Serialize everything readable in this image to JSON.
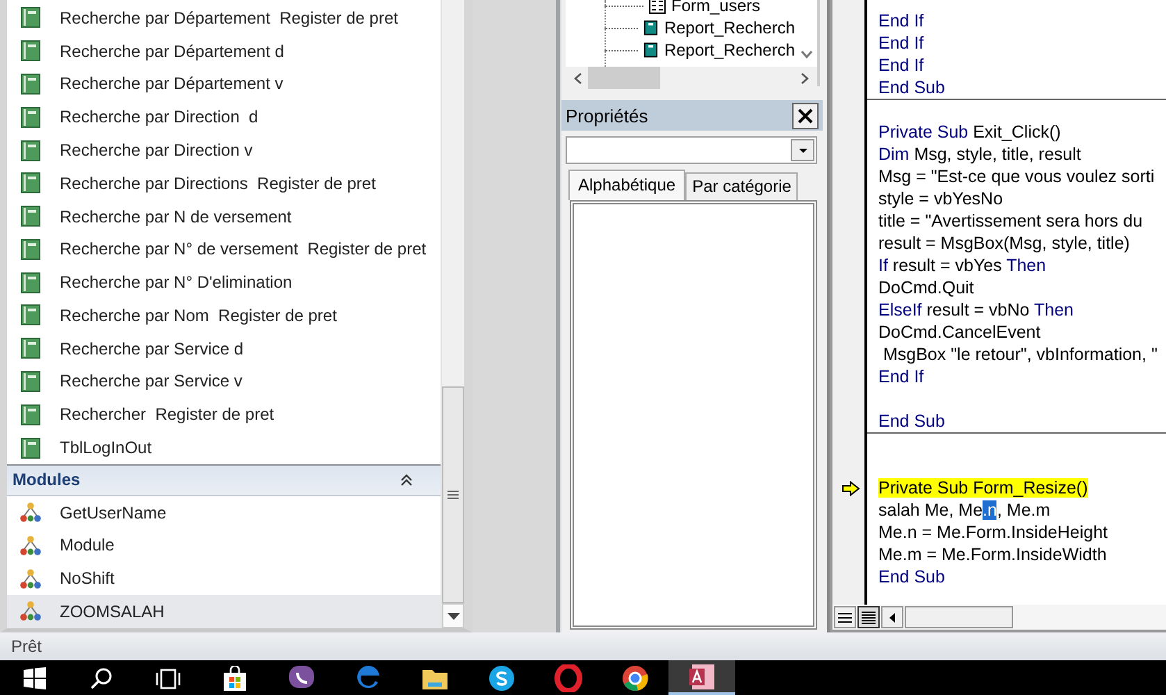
{
  "navigation_pane": {
    "form_items": [
      {
        "label": "Recherche par Département  Register de pret",
        "selected": false
      },
      {
        "label": "Recherche par Département d",
        "selected": false
      },
      {
        "label": "Recherche par Département v",
        "selected": false
      },
      {
        "label": "Recherche par Direction  d",
        "selected": false
      },
      {
        "label": "Recherche par Direction v",
        "selected": false
      },
      {
        "label": "Recherche par Directions  Register de pret",
        "selected": false
      },
      {
        "label": "Recherche par N de versement",
        "selected": false
      },
      {
        "label": "Recherche par N° de versement  Register de pret",
        "selected": false
      },
      {
        "label": "Recherche par N° D'elimination",
        "selected": false
      },
      {
        "label": "Recherche par Nom  Register de pret",
        "selected": false
      },
      {
        "label": "Recherche par Service d",
        "selected": false
      },
      {
        "label": "Recherche par Service v",
        "selected": false
      },
      {
        "label": "Rechercher  Register de pret",
        "selected": false
      },
      {
        "label": "TblLogInOut",
        "selected": false
      }
    ],
    "modules_section": {
      "title": "Modules",
      "expanded": true,
      "items": [
        {
          "label": "GetUserName",
          "selected": false
        },
        {
          "label": "Module",
          "selected": false
        },
        {
          "label": "NoShift",
          "selected": false
        },
        {
          "label": "ZOOMSALAH",
          "selected": true
        }
      ]
    }
  },
  "project_tree": {
    "items": [
      {
        "label": "Form_users",
        "kind": "form"
      },
      {
        "label": "Report_Recherch",
        "kind": "report"
      },
      {
        "label": "Report_Recherch",
        "kind": "report"
      }
    ]
  },
  "properties": {
    "title": "Propriétés",
    "tabs": [
      {
        "label": "Alphabétique",
        "selected": true
      },
      {
        "label": "Par catégorie",
        "selected": false
      }
    ]
  },
  "code": {
    "procedures": [
      {
        "lines": [
          {
            "kind": "code",
            "current": false,
            "segments": [
              {
                "text": "End If",
                "keyword": true,
                "selected": false
              }
            ]
          },
          {
            "kind": "code",
            "current": false,
            "segments": [
              {
                "text": "End If",
                "keyword": true,
                "selected": false
              }
            ]
          },
          {
            "kind": "code",
            "current": false,
            "segments": [
              {
                "text": "End If",
                "keyword": true,
                "selected": false
              }
            ]
          },
          {
            "kind": "code",
            "current": false,
            "segments": [
              {
                "text": "End Sub",
                "keyword": true,
                "selected": false
              }
            ]
          }
        ]
      },
      {
        "lines": [
          {
            "kind": "blank"
          },
          {
            "kind": "code",
            "current": false,
            "segments": [
              {
                "text": "Private Sub",
                "keyword": true,
                "selected": false
              },
              {
                "text": " Exit_Click()",
                "keyword": false,
                "selected": false
              }
            ]
          },
          {
            "kind": "code",
            "current": false,
            "segments": [
              {
                "text": "Dim",
                "keyword": true,
                "selected": false
              },
              {
                "text": " Msg, style, title, result",
                "keyword": false,
                "selected": false
              }
            ]
          },
          {
            "kind": "code",
            "current": false,
            "segments": [
              {
                "text": "Msg = \"Est-ce que vous voulez sorti",
                "keyword": false,
                "selected": false
              }
            ]
          },
          {
            "kind": "code",
            "current": false,
            "segments": [
              {
                "text": "style = vbYesNo",
                "keyword": false,
                "selected": false
              }
            ]
          },
          {
            "kind": "code",
            "current": false,
            "segments": [
              {
                "text": "title = \"Avertissement sera hors du",
                "keyword": false,
                "selected": false
              }
            ]
          },
          {
            "kind": "code",
            "current": false,
            "segments": [
              {
                "text": "result = MsgBox(Msg, style, title)",
                "keyword": false,
                "selected": false
              }
            ]
          },
          {
            "kind": "code",
            "current": false,
            "segments": [
              {
                "text": "If",
                "keyword": true,
                "selected": false
              },
              {
                "text": " result = vbYes ",
                "keyword": false,
                "selected": false
              },
              {
                "text": "Then",
                "keyword": true,
                "selected": false
              }
            ]
          },
          {
            "kind": "code",
            "current": false,
            "segments": [
              {
                "text": "DoCmd.Quit",
                "keyword": false,
                "selected": false
              }
            ]
          },
          {
            "kind": "code",
            "current": false,
            "segments": [
              {
                "text": "ElseIf",
                "keyword": true,
                "selected": false
              },
              {
                "text": " result = vbNo ",
                "keyword": false,
                "selected": false
              },
              {
                "text": "Then",
                "keyword": true,
                "selected": false
              }
            ]
          },
          {
            "kind": "code",
            "current": false,
            "segments": [
              {
                "text": "DoCmd.CancelEvent",
                "keyword": false,
                "selected": false
              }
            ]
          },
          {
            "kind": "code",
            "current": false,
            "segments": [
              {
                "text": " MsgBox \"le retour\", vbInformation, \"",
                "keyword": false,
                "selected": false
              }
            ]
          },
          {
            "kind": "code",
            "current": false,
            "segments": [
              {
                "text": "End If",
                "keyword": true,
                "selected": false
              }
            ]
          },
          {
            "kind": "blank"
          },
          {
            "kind": "code",
            "current": false,
            "segments": [
              {
                "text": "End Sub",
                "keyword": true,
                "selected": false
              }
            ]
          }
        ]
      },
      {
        "lines": [
          {
            "kind": "blank"
          },
          {
            "kind": "blank"
          },
          {
            "kind": "code",
            "current": true,
            "segments": [
              {
                "text": "Private Sub Form_Resize()",
                "keyword": false,
                "selected": false
              }
            ]
          },
          {
            "kind": "code",
            "current": false,
            "segments": [
              {
                "text": "salah Me, Me",
                "keyword": false,
                "selected": false
              },
              {
                "text": ".n",
                "keyword": false,
                "selected": true
              },
              {
                "text": ", Me.m",
                "keyword": false,
                "selected": false
              }
            ]
          },
          {
            "kind": "code",
            "current": false,
            "segments": [
              {
                "text": "Me.n = Me.Form.InsideHeight",
                "keyword": false,
                "selected": false
              }
            ]
          },
          {
            "kind": "code",
            "current": false,
            "segments": [
              {
                "text": "Me.m = Me.Form.InsideWidth",
                "keyword": false,
                "selected": false
              }
            ]
          },
          {
            "kind": "code",
            "current": false,
            "segments": [
              {
                "text": "End Sub",
                "keyword": true,
                "selected": false
              }
            ]
          }
        ]
      }
    ],
    "view_buttons": [
      {
        "kind": "procedure",
        "selected": false
      },
      {
        "kind": "module",
        "selected": true
      }
    ]
  },
  "status_bar": {
    "text": "Prêt"
  },
  "taskbar": {
    "items": [
      {
        "kind": "start",
        "selected": false
      },
      {
        "kind": "search",
        "selected": false
      },
      {
        "kind": "taskview",
        "selected": false
      },
      {
        "kind": "store",
        "selected": false
      },
      {
        "kind": "viber",
        "selected": false
      },
      {
        "kind": "edge",
        "selected": false
      },
      {
        "kind": "folder",
        "selected": false
      },
      {
        "kind": "skype",
        "selected": false
      },
      {
        "kind": "opera",
        "selected": false
      },
      {
        "kind": "chrome",
        "selected": false
      },
      {
        "kind": "access",
        "selected": true
      }
    ]
  }
}
